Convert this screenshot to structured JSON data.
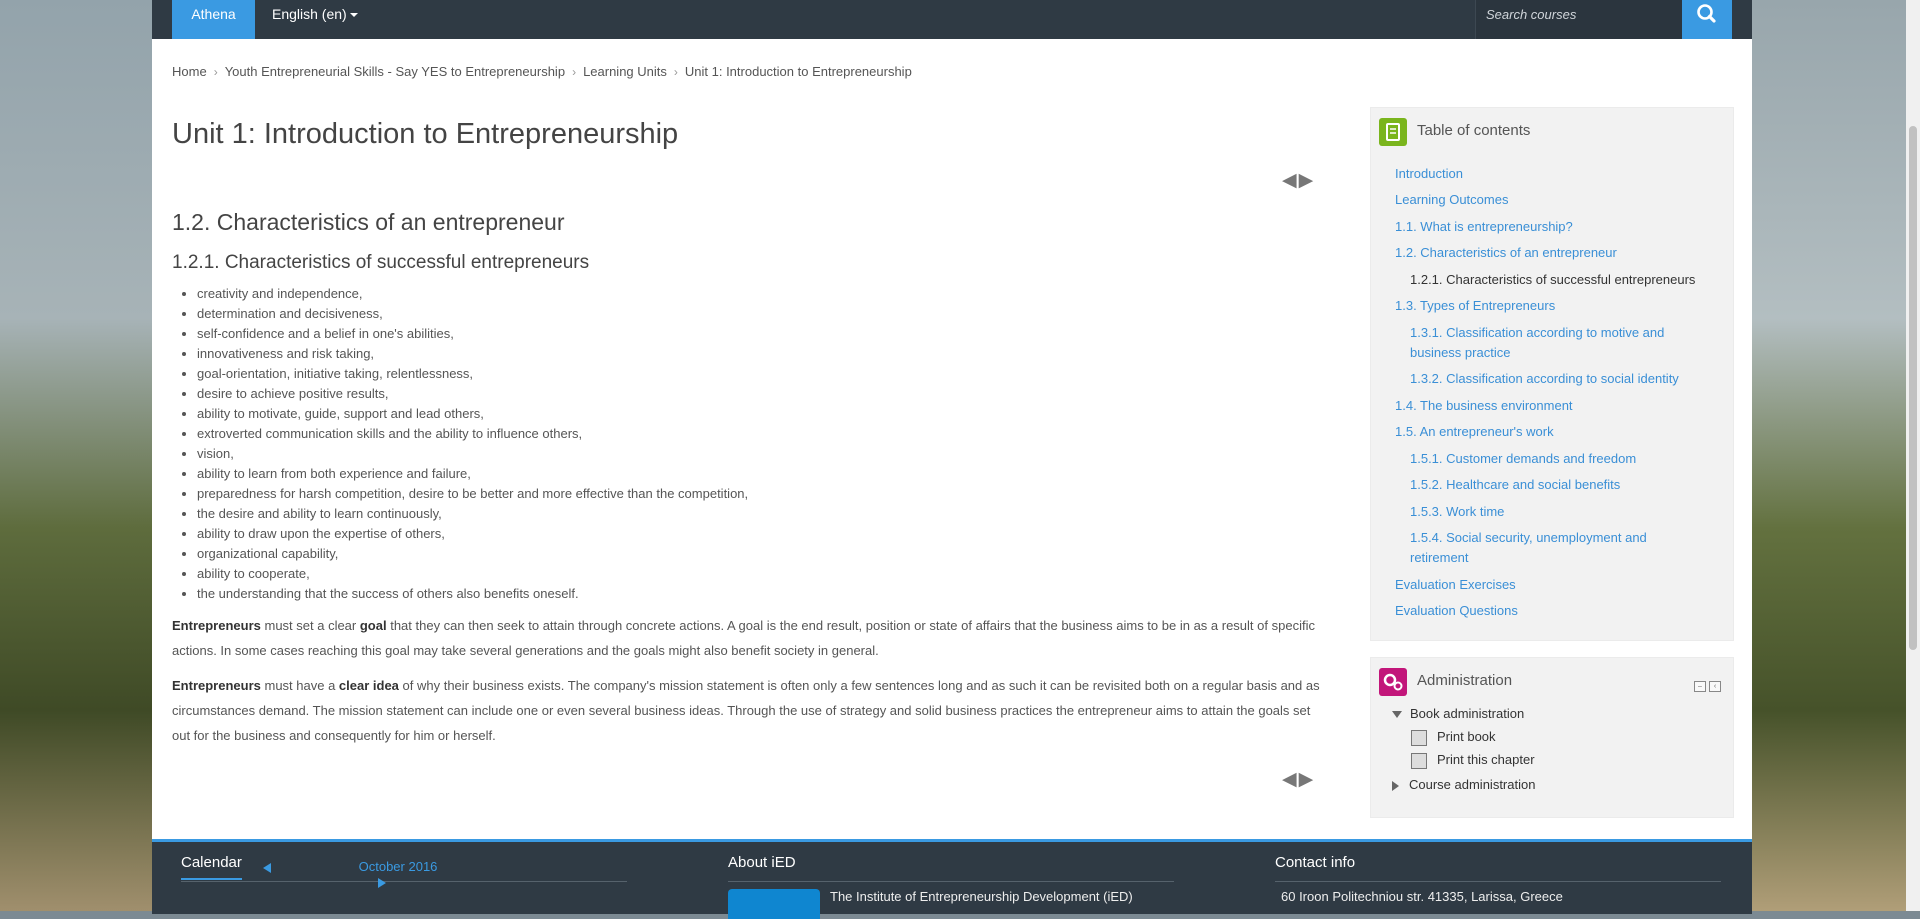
{
  "navbar": {
    "brand": "Athena",
    "language": "English (en)",
    "search_placeholder": "Search courses"
  },
  "breadcrumb": [
    "Home",
    "Youth Entrepreneurial Skills - Say YES to Entrepreneurship",
    "Learning Units",
    "Unit 1: Introduction to Entrepreneurship"
  ],
  "main": {
    "title": "Unit 1: Introduction to Entrepreneurship",
    "chapter": "1.2. Characteristics of an entrepreneur",
    "subchapter": "1.2.1. Characteristics of successful entrepreneurs",
    "traits": [
      "creativity and independence,",
      "determination and decisiveness,",
      "self-confidence and a belief in one's abilities,",
      "innovativeness and risk taking,",
      "goal-orientation, initiative taking,  relentlessness,",
      "desire to achieve positive results,",
      "ability to motivate, guide, support and lead others,",
      "extroverted communication skills and the ability to influence others,",
      "vision,",
      "ability to learn from both experience and failure,",
      "preparedness for harsh competition, desire to be better and more effective than the competition,",
      "the desire and ability to learn continuously,",
      "ability to draw upon the expertise of others,",
      "organizational capability,",
      "ability to cooperate,",
      "the understanding that the success of others also benefits oneself."
    ],
    "para1": {
      "b1": "Entrepreneurs",
      "t1": " must set a clear ",
      "b2": "goal",
      "t2": " that they can then seek to attain through concrete actions. A goal is the end result, position or state of affairs that the business aims to be in as a result of specific actions. In some cases reaching this goal may take several generations and the goals might also benefit society in general."
    },
    "para2": {
      "b1": "Entrepreneurs",
      "t1": " must have a ",
      "b2": "clear idea",
      "t2": " of why their business exists. The company's mission statement is often only a few sentences long and as such it can be revisited both on a regular basis and as circumstances demand. The mission statement can include one or even several business ideas. Through the use of strategy and solid business practices the entrepreneur aims to attain the goals set out for the business and consequently for him or herself."
    }
  },
  "toc": {
    "title": "Table of contents",
    "items": [
      "Introduction",
      "Learning Outcomes",
      "1.1. What is entrepreneurship?",
      "1.2. Characteristics of an entrepreneur",
      "1.2.1. Characteristics of successful entrepreneurs",
      "1.3. Types of Entrepreneurs",
      "1.3.1. Classification according to motive and business practice",
      "1.3.2. Classification according to social identity",
      "1.4. The business environment",
      "1.5. An entrepreneur's work",
      "1.5.1. Customer demands and freedom",
      "1.5.2. Healthcare and social benefits",
      "1.5.3. Work time",
      "1.5.4. Social security, unemployment and retirement",
      "Evaluation Exercises",
      "Evaluation Questions"
    ]
  },
  "admin": {
    "title": "Administration",
    "book_admin": "Book administration",
    "print_book": "Print book",
    "print_chapter": "Print this chapter",
    "course_admin": "Course administration"
  },
  "footer": {
    "calendar_title": "Calendar",
    "month": "October 2016",
    "about_title": "About iED",
    "about_text": "The Institute of Entrepreneurship Development (iED)",
    "contact_title": "Contact info",
    "contact_text": "60 Iroon Politechniou str. 41335, Larissa, Greece"
  },
  "colors": {
    "accent": "#3a9ae2",
    "navbar": "#2f3a44",
    "toc_icon": "#7ab51d",
    "admin_icon": "#c2167a"
  }
}
